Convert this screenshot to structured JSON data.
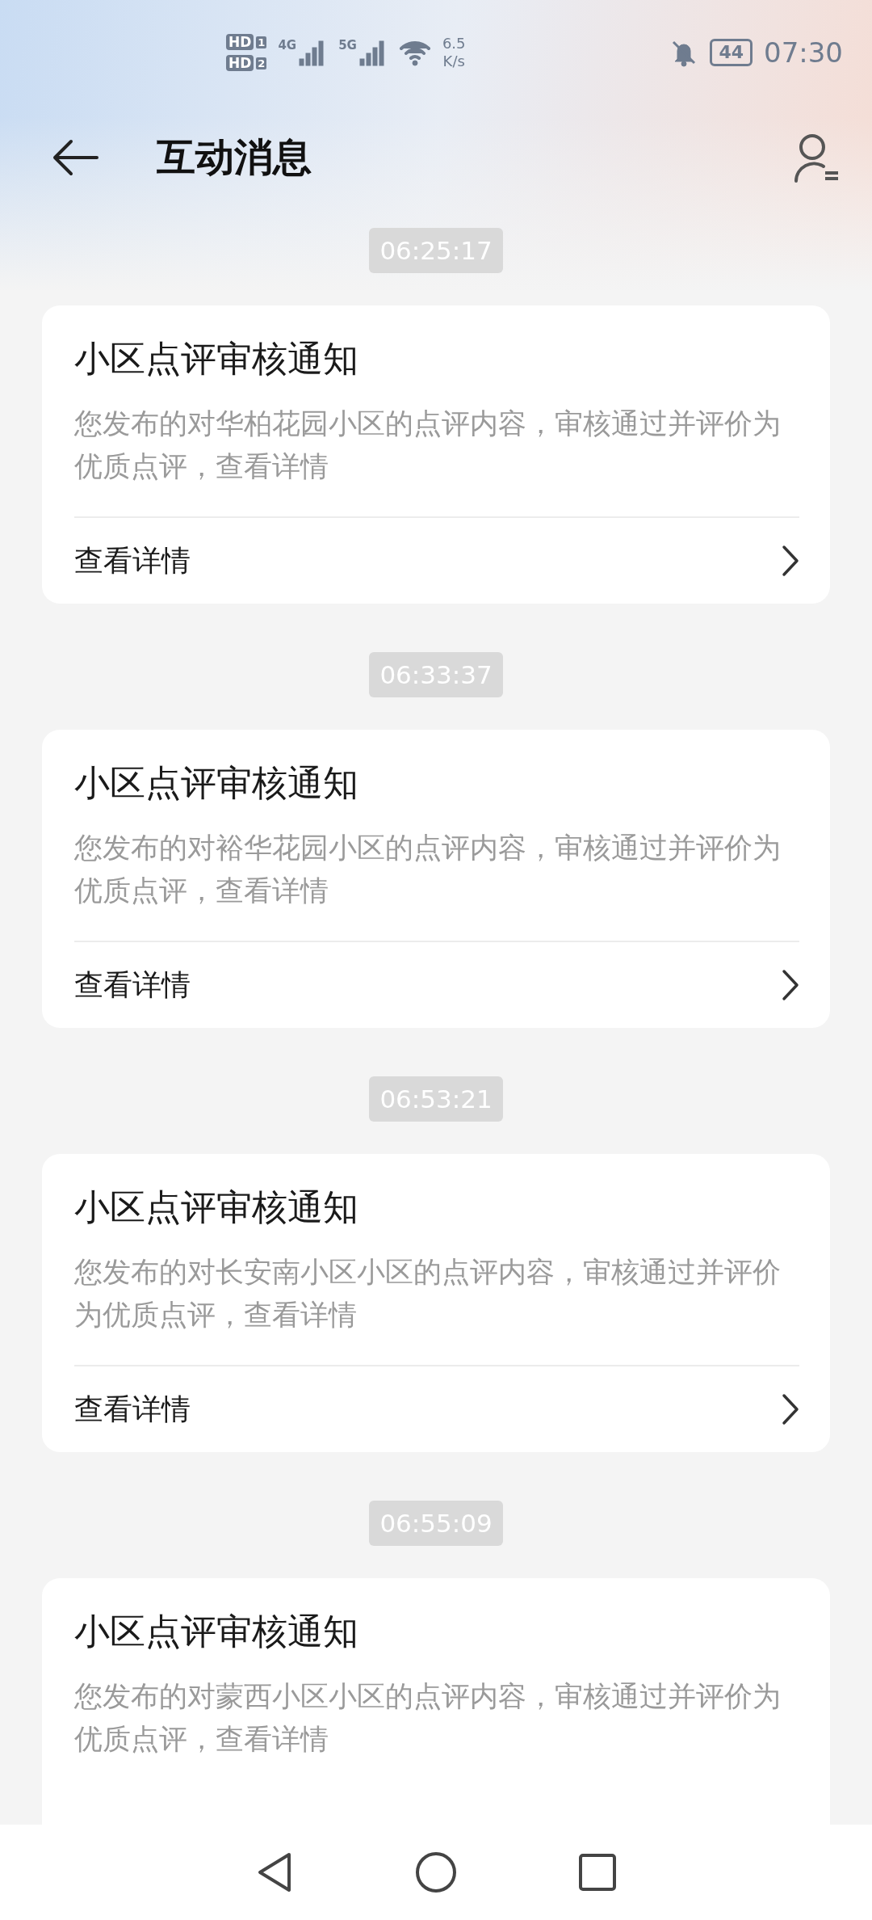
{
  "status_bar": {
    "sim_labels": [
      "HD",
      "HD"
    ],
    "sim_numbers": [
      "1",
      "2"
    ],
    "networks": [
      "4G",
      "5G"
    ],
    "speed": "6.5",
    "speed_unit": "K/s",
    "battery": "44",
    "time": "07:30"
  },
  "header": {
    "title": "互动消息"
  },
  "messages": [
    {
      "time": "06:25:17",
      "title": "小区点评审核通知",
      "body": "您发布的对华柏花园小区的点评内容，审核通过并评价为优质点评，查看详情",
      "link": "查看详情"
    },
    {
      "time": "06:33:37",
      "title": "小区点评审核通知",
      "body": "您发布的对裕华花园小区的点评内容，审核通过并评价为优质点评，查看详情",
      "link": "查看详情"
    },
    {
      "time": "06:53:21",
      "title": "小区点评审核通知",
      "body": "您发布的对长安南小区小区的点评内容，审核通过并评价为优质点评，查看详情",
      "link": "查看详情"
    },
    {
      "time": "06:55:09",
      "title": "小区点评审核通知",
      "body": "您发布的对蒙西小区小区的点评内容，审核通过并评价为优质点评，查看详情"
    }
  ]
}
